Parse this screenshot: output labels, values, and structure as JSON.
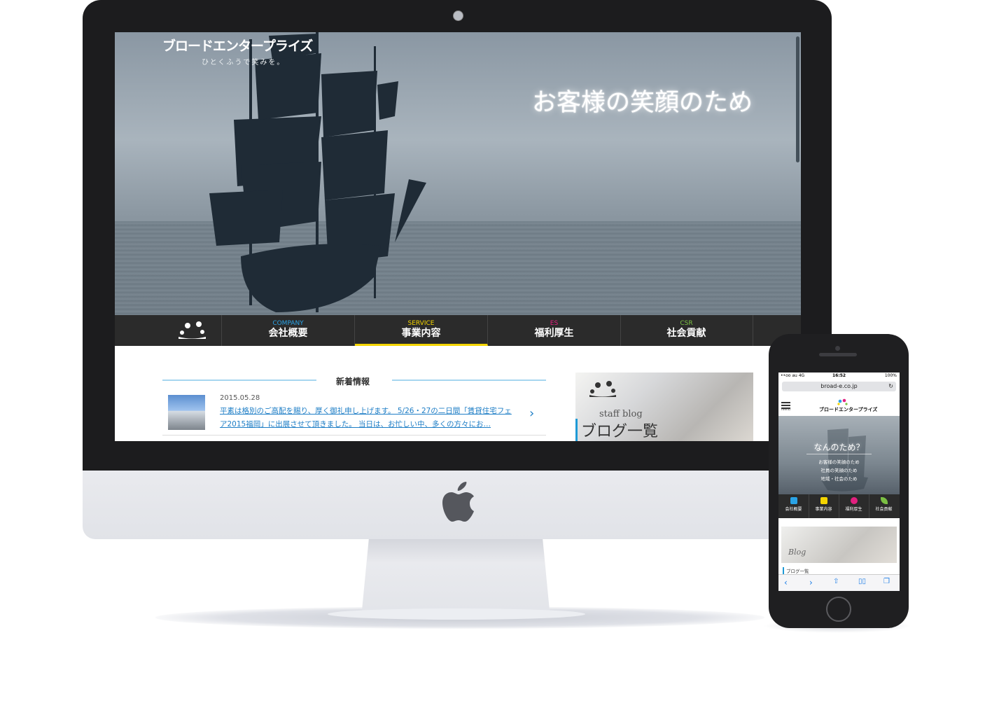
{
  "desktop": {
    "brand": "ブロードエンタープライズ",
    "tagline": "ひとくふうで笑みを。",
    "hero_copy": "お客様の笑顔のため",
    "nav": [
      {
        "en": "COMPANY",
        "jp": "会社概要",
        "en_color": "#2aa3e6"
      },
      {
        "en": "SERVICE",
        "jp": "事業内容",
        "en_color": "#f4d400"
      },
      {
        "en": "ES",
        "jp": "福利厚生",
        "en_color": "#e2207f"
      },
      {
        "en": "CSR",
        "jp": "社会貢献",
        "en_color": "#7bc043"
      }
    ],
    "news": {
      "title": "新着情報",
      "date": "2015.05.28",
      "text": "平素は格別のご高配を賜り、厚く御礼申し上げます。 5/26・27の二日間「賃貸住宅フェア2015福岡」に出展させて頂きました。 当日は、お忙しい中、多くの方々にお…"
    },
    "blog": {
      "en": "staff blog",
      "jp": "ブログ一覧"
    }
  },
  "phone": {
    "status_left": "••oo au 4G",
    "time": "16:52",
    "battery": "100%",
    "url": "broad-e.co.jp",
    "menu_label": "menu",
    "brand": "ブロードエンタープライズ",
    "hero_title": "なんのため？",
    "hero_lines": [
      "お客様の笑顔のため",
      "社員の笑顔のため",
      "地域・社会のため"
    ],
    "nav": [
      {
        "label": "会社概要",
        "color": "#2aa3e6"
      },
      {
        "label": "事業内容",
        "color": "#f4d400"
      },
      {
        "label": "福利厚生",
        "color": "#e2207f"
      },
      {
        "label": "社会貢献",
        "color": "#7bc043"
      }
    ],
    "blog_word": "Blog",
    "blog_label": "ブログ一覧"
  }
}
